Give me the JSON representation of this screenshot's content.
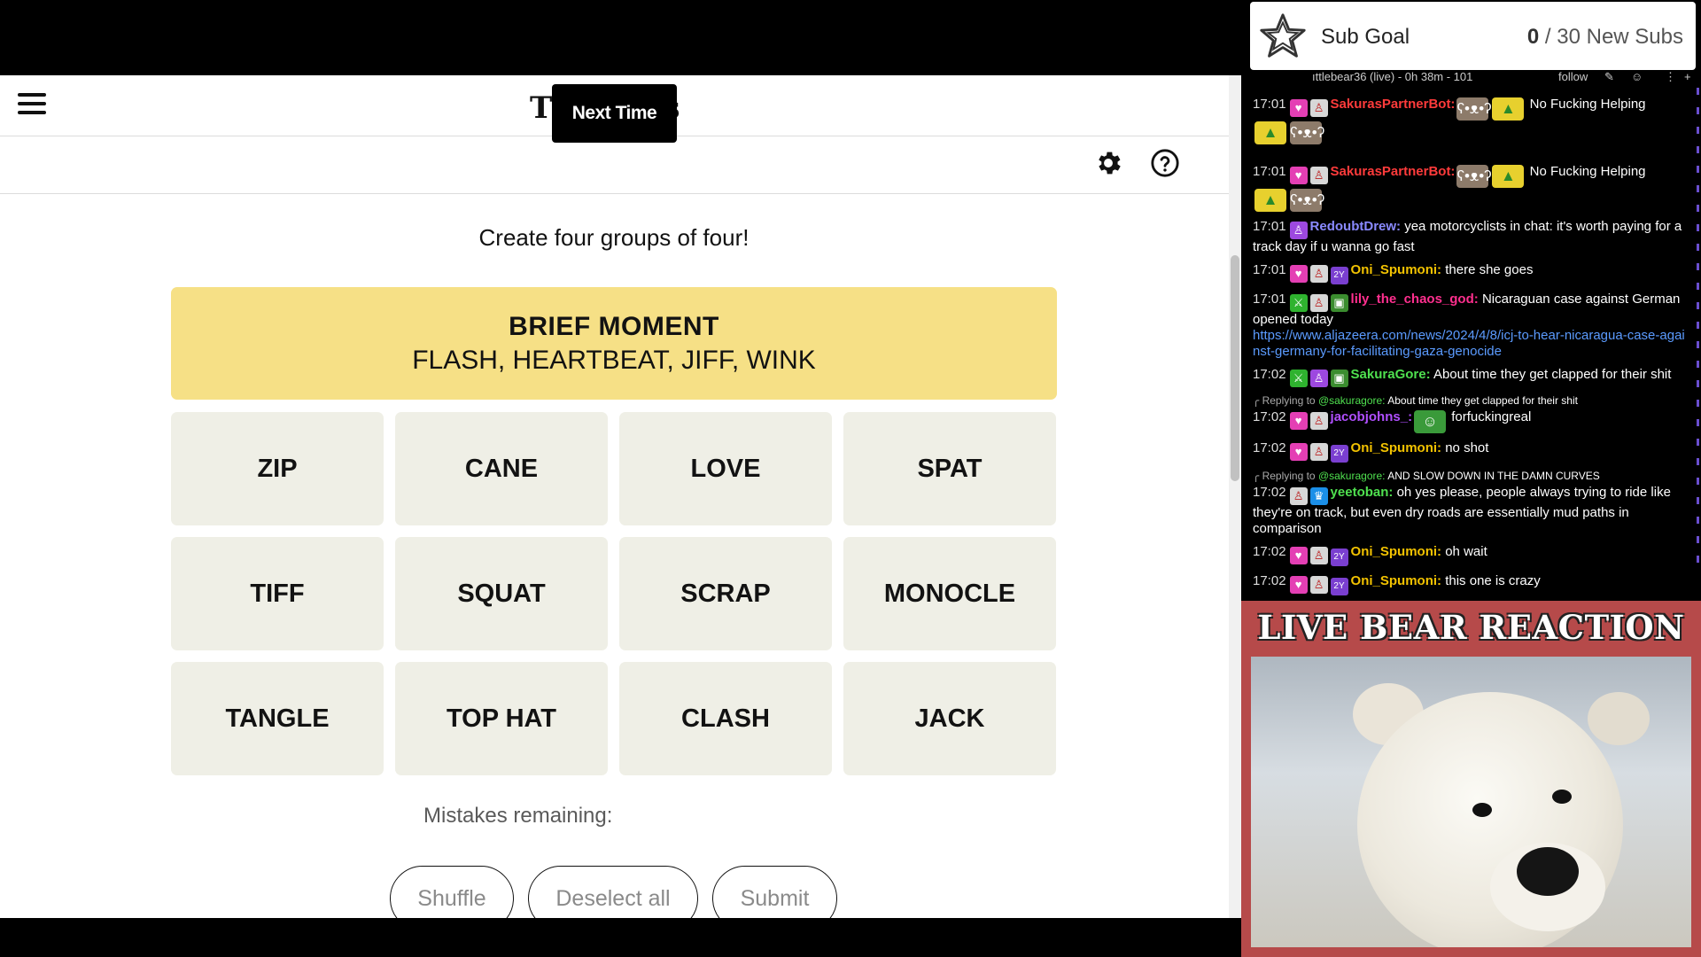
{
  "game": {
    "logo_left": "T",
    "logo_right": "s",
    "toast": "Next Time",
    "instructions": "Create four groups of four!",
    "solved_group": {
      "title": "BRIEF MOMENT",
      "members": "FLASH, HEARTBEAT, JIFF, WINK",
      "color": "#f6e086"
    },
    "tiles": [
      "ZIP",
      "CANE",
      "LOVE",
      "SPAT",
      "TIFF",
      "SQUAT",
      "SCRAP",
      "MONOCLE",
      "TANGLE",
      "TOP HAT",
      "CLASH",
      "JACK"
    ],
    "mistakes_label": "Mistakes remaining:",
    "buttons": {
      "shuffle": "Shuffle",
      "deselect": "Deselect all",
      "submit": "Submit"
    },
    "icons": [
      "hamburger-menu-icon",
      "gear-icon",
      "help-icon"
    ]
  },
  "sub_goal": {
    "label": "Sub Goal",
    "current": "0",
    "target": "/ 30 New Subs",
    "icon": "star-icon"
  },
  "chat": {
    "header_title": "ıttlebear36 (live) - 0h 38m - 101",
    "header_follow": "follow",
    "messages": [
      {
        "time": "17:01",
        "user": "SakurasPartnerBot:",
        "color": "#ff3b3b",
        "text": "No Fucking Helping"
      },
      {
        "time": "17:01",
        "user": "SakurasPartnerBot:",
        "color": "#ff3b3b",
        "text": "No Fucking Helping"
      },
      {
        "time": "17:01",
        "user": "RedoubtDrew:",
        "color": "#8a8aff",
        "text": "yea motorcyclists in chat: it's worth paying for a track day if u wanna go fast"
      },
      {
        "time": "17:01",
        "user": "Oni_Spumoni:",
        "color": "#f2c200",
        "text": "there she goes"
      },
      {
        "time": "17:01",
        "user": "lily_the_chaos_god:",
        "color": "#ff2f8e",
        "text": "Nicaraguan case against German opened today",
        "link": "https://www.aljazeera.com/news/2024/4/8/icj-to-hear-nicaragua-case-against-germany-for-facilitating-gaza-genocide"
      },
      {
        "time": "17:02",
        "user": "SakuraGore:",
        "color": "#4fe04f",
        "text": "About time they get clapped for their shit"
      },
      {
        "reply_prefix": "Replying to",
        "reply_user": "@sakuragore:",
        "reply_text": "About time they get clapped for their shit",
        "time": "17:02",
        "user": "jacobjohns_:",
        "color": "#b04fff",
        "text": "forfuckingreal"
      },
      {
        "time": "17:02",
        "user": "Oni_Spumoni:",
        "color": "#f2c200",
        "text": "no shot"
      },
      {
        "reply_prefix": "Replying to",
        "reply_user": "@sakuragore:",
        "reply_text": "AND SLOW DOWN IN THE DAMN CURVES",
        "time": "17:02",
        "user": "yeetoban:",
        "color": "#4fe04f",
        "text": "oh yes please, people always trying to ride like they're on track, but even dry roads are essentially mud paths in comparison"
      },
      {
        "time": "17:02",
        "user": "Oni_Spumoni:",
        "color": "#f2c200",
        "text": "oh wait"
      },
      {
        "time": "17:02",
        "user": "Oni_Spumoni:",
        "color": "#f2c200",
        "text": "this one is crazy"
      }
    ]
  },
  "bear_panel": {
    "title": "LIVE BEAR REACTION",
    "background": "#b64a4a"
  }
}
